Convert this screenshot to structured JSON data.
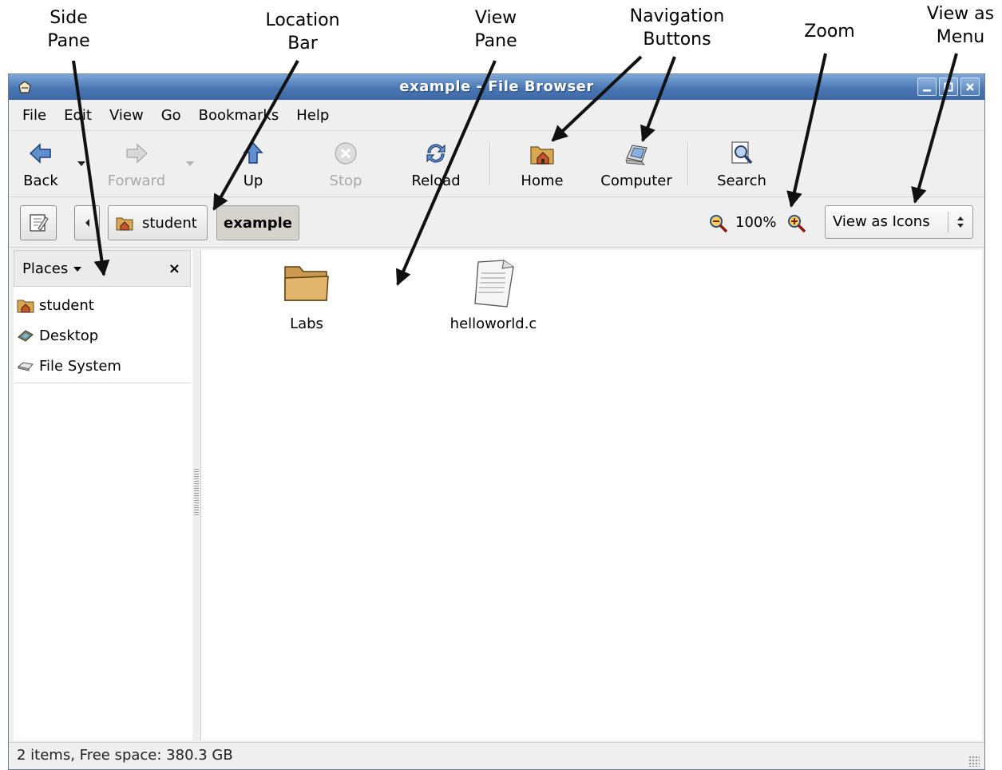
{
  "annotations": {
    "side_pane": [
      "Side",
      "Pane"
    ],
    "location_bar": [
      "Location",
      "Bar"
    ],
    "view_pane": [
      "View",
      "Pane"
    ],
    "navigation_buttons": [
      "Navigation",
      "Buttons"
    ],
    "zoom": "Zoom",
    "view_as_menu": [
      "View as",
      "Menu"
    ]
  },
  "window": {
    "title": "example - File Browser"
  },
  "menubar": {
    "items": [
      "File",
      "Edit",
      "View",
      "Go",
      "Bookmarks",
      "Help"
    ]
  },
  "toolbar": {
    "back": "Back",
    "forward": "Forward",
    "up": "Up",
    "stop": "Stop",
    "reload": "Reload",
    "home": "Home",
    "computer": "Computer",
    "search": "Search"
  },
  "location": {
    "crumbs": [
      "student",
      "example"
    ],
    "zoom_level": "100%",
    "view_mode": "View as Icons"
  },
  "side_pane": {
    "header": "Places",
    "items": [
      "student",
      "Desktop",
      "File System"
    ]
  },
  "view_pane": {
    "files": [
      {
        "name": "Labs",
        "icon": "folder-icon"
      },
      {
        "name": "helloworld.c",
        "icon": "text-file-icon"
      }
    ]
  },
  "statusbar": {
    "text": "2 items, Free space: 380.3 GB"
  },
  "colors": {
    "titlebar": "#4a77b4",
    "folder": "#e2b56d"
  }
}
